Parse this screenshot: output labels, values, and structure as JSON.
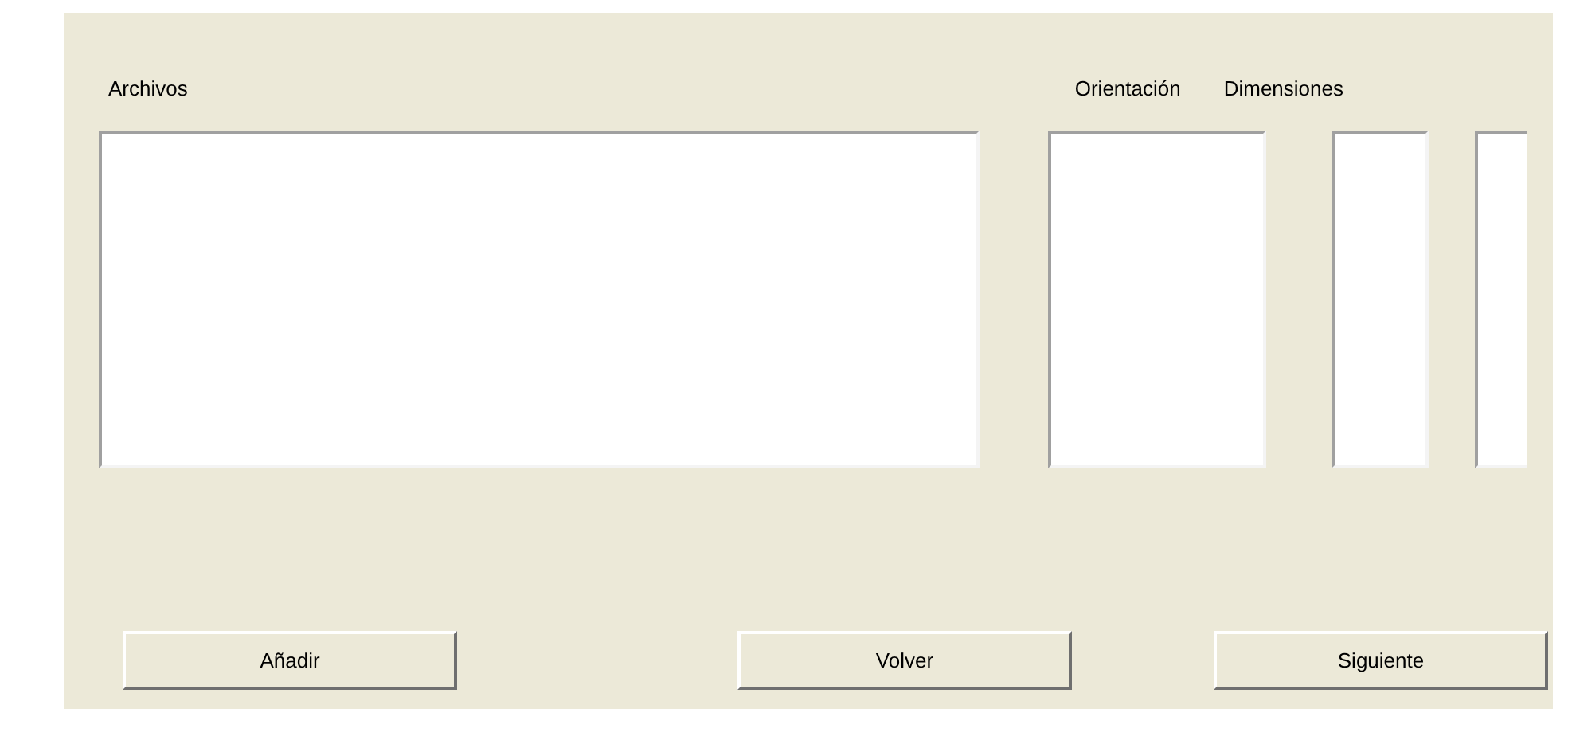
{
  "files": {
    "label": "Archivos"
  },
  "orientation": {
    "label": "Orientación"
  },
  "dimensions": {
    "label": "Dimensiones"
  },
  "buttons": [
    "Añadir",
    "Volver",
    "Siguiente"
  ]
}
